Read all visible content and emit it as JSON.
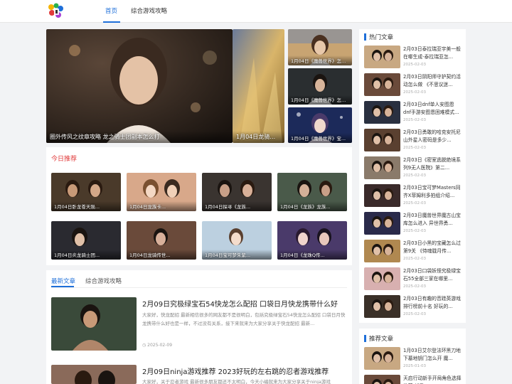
{
  "nav": {
    "items": [
      {
        "label": "首页",
        "active": true
      },
      {
        "label": "综合游戏攻略",
        "active": false
      }
    ]
  },
  "hero": {
    "main_caption": "圈外传风之纹章攻略 龙之骑士团副本怎么打",
    "second_caption": "1月04日龙骑传 副",
    "side": [
      {
        "caption": "1月04日《魔兽世界》怎么刷公..."
      },
      {
        "caption": "1月04日《魔兽世界》怎么..."
      },
      {
        "caption": "1月04日《魔兽世界》宝..."
      }
    ]
  },
  "today": {
    "title": "今日推荐",
    "items": [
      {
        "caption": "1月04日卧龙苍天陨..."
      },
      {
        "caption": "1月04日龙族卡..."
      },
      {
        "caption": "1月04日探寻《龙族..."
      },
      {
        "caption": "1月04日《龙族》龙族..."
      },
      {
        "caption": "1月04日炎龙骑士团..."
      },
      {
        "caption": "1月04日龙骑传世..."
      },
      {
        "caption": "1月04日宝可梦朱紫..."
      },
      {
        "caption": "1月04日《龙珠Q传..."
      }
    ]
  },
  "tabs": [
    {
      "label": "最新文章",
      "active": true
    },
    {
      "label": "综合游戏攻略",
      "active": false
    }
  ],
  "articles": [
    {
      "title": "2月09日究极绿宝石54快龙怎么配招 口袋日月快龙携带什么好",
      "desc": "大家好，快龙配招 最新相信很多的网友都不是很明白，包括究极绿宝石54快龙怎么配招 口袋日月快龙携带什么好也是一样，不过没有关系，接下来就来为大家分享关于快龙配招 最新...",
      "date": "2025-02-09"
    },
    {
      "title": "2月09日ninja游戏推荐 2023好玩的左右跳的忍者游戏推荐",
      "desc": "大家好，关于忍者游戏 最新很多朋友都还不太明白，今天小编就来为大家分享关于ninja游戏",
      "date": ""
    }
  ],
  "hot": {
    "title": "热门文章",
    "items": [
      {
        "title": "2月03日泰拉瑞亚宇美一般在哪生成-泰拉瑞亚怎...",
        "date": "2025-02-03"
      },
      {
        "title": "2月03日阴阳师守护契约活动怎么做 《不思议迷...",
        "date": "2025-02-03"
      },
      {
        "title": "2月03日dnf单人安图恩dnf手游安图恩困难模式...",
        "date": "2025-02-03"
      },
      {
        "title": "2月03日勇敢的哈克安托尼山外星人密码是多少...",
        "date": "2025-02-03"
      },
      {
        "title": "2月03日《密室逃脱绝境系列9无人医院》第二...",
        "date": "2025-02-03"
      },
      {
        "title": "2月03日宝可梦Masters同齐X菲姆利多拍组介绍...",
        "date": "2025-02-03"
      },
      {
        "title": "2月03日魔兽世界魔古山宝库怎么进入 异世界勇...",
        "date": "2025-02-03"
      },
      {
        "title": "2月03日小黑的宝藏怎么过第9关 《侍魂胧月传...",
        "date": "2025-02-03"
      },
      {
        "title": "2月03日口袋妖怪究极绿宝石55全部三家在哪里...",
        "date": "2025-02-03"
      },
      {
        "title": "2月03日有趣的音跬英游戏排行榜前十名 好玩的...",
        "date": "2025-02-03"
      }
    ]
  },
  "recommend": {
    "title": "推荐文章",
    "items": [
      {
        "title": "1月03日艾尔登法环黑刀地下墓地钥门怎么开 魔...",
        "date": "2025-01-03"
      },
      {
        "title": "天启行动新手开局角色选择推荐 新手...",
        "date": ""
      }
    ]
  },
  "colors": {
    "accent": "#1e6fd9",
    "section_red": "#e03a3a"
  }
}
